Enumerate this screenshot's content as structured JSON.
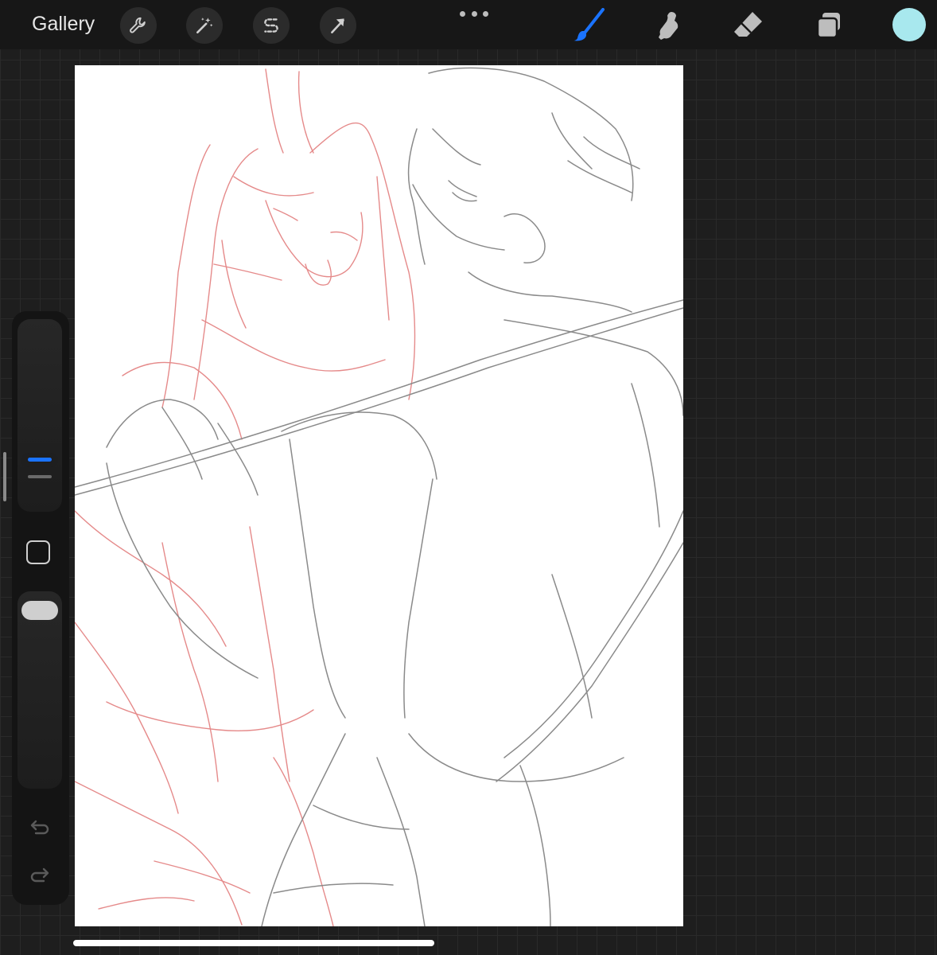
{
  "topbar": {
    "gallery_label": "Gallery",
    "left_tools": [
      {
        "icon": "wrench-icon",
        "name": "actions"
      },
      {
        "icon": "magic-wand-icon",
        "name": "adjustments"
      },
      {
        "icon": "selection-s-icon",
        "name": "selection"
      },
      {
        "icon": "transform-arrow-icon",
        "name": "transform"
      }
    ],
    "more_icon": "ellipsis-icon",
    "right_tools": [
      {
        "icon": "brush-icon",
        "name": "paint",
        "active": true
      },
      {
        "icon": "smudge-icon",
        "name": "smudge",
        "active": false
      },
      {
        "icon": "eraser-icon",
        "name": "erase",
        "active": false
      },
      {
        "icon": "layers-icon",
        "name": "layers",
        "active": false
      }
    ],
    "current_color": "#a8e8ee",
    "accent_color": "#1a73ff"
  },
  "canvas": {
    "background": "#ffffff",
    "sketch_colors": {
      "layer_red": "#e58a8a",
      "layer_gray": "#8a8a8a"
    }
  },
  "sidebar": {
    "brush_size_level": 0.47,
    "opacity_level": 0.08,
    "modify_icon": "square-modify-icon",
    "undo_icon": "undo-arrow-icon",
    "redo_icon": "redo-arrow-icon"
  }
}
